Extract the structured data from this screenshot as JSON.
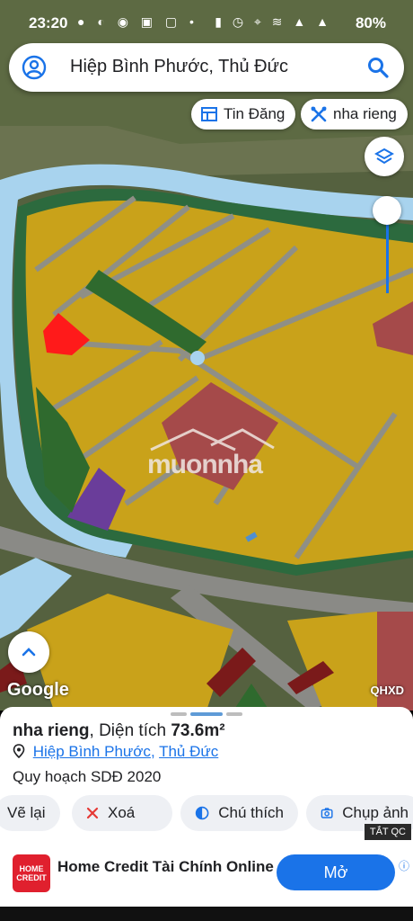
{
  "status_bar": {
    "time": "23:20",
    "battery": "80%",
    "icons": [
      "message-icon",
      "clock-icon",
      "chrome-icon",
      "shop-icon",
      "app-icon",
      "dot",
      "lock-icon",
      "alarm-icon",
      "location-icon",
      "wifi-icon",
      "signal-icon"
    ]
  },
  "search": {
    "query": "Hiệp Bình Phước, Thủ Đức"
  },
  "chips": {
    "listings": "Tin Đăng",
    "keyword": "nha rieng"
  },
  "map": {
    "watermark": "muonnha",
    "google_label": "Google",
    "layer_label": "QHXD",
    "colors": {
      "residential": "#c9a21a",
      "commercial": "#a54a4a",
      "park": "#2f6a2e",
      "water": "#a8d3ee",
      "selected": "#ff1a1a",
      "public": "#6a3d9a"
    }
  },
  "sheet": {
    "title_prefix": "nha rieng",
    "area_label": ", Diện tích ",
    "area_value": "73.6m²",
    "ward": "Hiệp Bình Phước",
    "separator": ", ",
    "district": "Thủ Đức",
    "plan": "Quy hoạch SDĐ 2020",
    "actions": {
      "draw_again": "Vẽ lại",
      "delete": "Xoá",
      "legend": "Chú thích",
      "screenshot": "Chụp ảnh"
    }
  },
  "ad": {
    "close_label": "TẮT QC",
    "logo_text": "HOME CREDIT",
    "title": "Home Credit Tài Chính Online",
    "cta": "Mở"
  }
}
